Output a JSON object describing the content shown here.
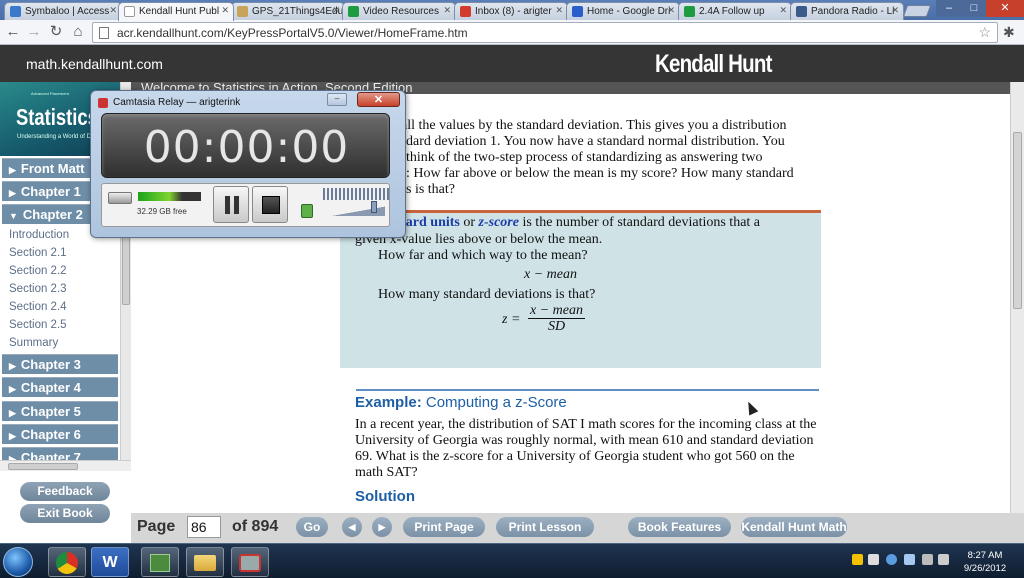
{
  "browser": {
    "tabs": [
      {
        "label": "Symbaloo | Access",
        "fav_color": "#3a78c9"
      },
      {
        "label": "Kendall Hunt Publ",
        "fav_color": "#ffffff",
        "active": true
      },
      {
        "label": "GPS_21Things4Edu",
        "fav_color": "#c8a35a"
      },
      {
        "label": "Video Resources",
        "fav_color": "#1e9b3e"
      },
      {
        "label": "Inbox (8) - arigter",
        "fav_color": "#d33b2c"
      },
      {
        "label": "Home - Google Dri",
        "fav_color": "#2a5fcb"
      },
      {
        "label": "2.4A Follow up",
        "fav_color": "#1e9b3e"
      },
      {
        "label": "Pandora Radio - Li",
        "fav_color": "#3a5a8c"
      }
    ],
    "url": "acr.kendallhunt.com/KeyPressPortalV5.0/Viewer/HomeFrame.htm",
    "window_buttons": [
      "–",
      "□",
      "✕"
    ]
  },
  "site": {
    "link": "math.kendallhunt.com",
    "logo": "Kendall Hunt",
    "welcome": "Welcome to Statistics in Action, Second Edition"
  },
  "book_cover": {
    "small": "Advanced Placement",
    "title": "Statistics",
    "subtitle": "Understanding a World of D"
  },
  "sidebar": {
    "chapters": [
      {
        "label": "Front Matt"
      },
      {
        "label": "Chapter 1"
      },
      {
        "label": "Chapter 2"
      },
      {
        "label": "Chapter 3"
      },
      {
        "label": "Chapter 4"
      },
      {
        "label": "Chapter 5"
      },
      {
        "label": "Chapter 6"
      },
      {
        "label": "Chapter 7"
      }
    ],
    "sections": [
      "Introduction",
      "Section 2.1",
      "Section 2.2",
      "Section 2.3",
      "Section 2.4",
      "Section 2.5",
      "Summary"
    ],
    "feedback": "Feedback",
    "exit_book": "Exit Book"
  },
  "content": {
    "para1": [
      "all the values by the standard deviation. This gives you a distribution",
      "dard deviation 1. You now have a standard normal distribution. You",
      "think of the two-step process of standardizing as answering two",
      ": How far above or below the mean is my score? How many standard",
      "s is that?"
    ],
    "def_keyword1": "dard units",
    "def_or": "or",
    "def_keyword2": "z-score",
    "def_rest": "is the number of standard deviations that a",
    "def_line2": "given x-value lies above or below the mean.",
    "q1": "How far and which way to the mean?",
    "formula1": "x − mean",
    "q2": "How many standard deviations is that?",
    "z_lhs": "z =",
    "z_num": "x − mean",
    "z_den": "SD",
    "example_label": "Example:",
    "example_title": "Computing a z-Score",
    "example_text": [
      "In a recent year, the distribution of SAT I math scores for the incoming class at the",
      "University of Georgia was roughly normal, with mean 610 and standard deviation",
      "69. What is the z-score for a University of Georgia student who got 560 on the",
      "math SAT?"
    ],
    "solution": "Solution"
  },
  "bottom": {
    "page_label": "Page",
    "page_value": "86",
    "of_label": "of 894",
    "go": "Go",
    "print_page": "Print Page",
    "print_lesson": "Print Lesson",
    "book_features": "Book Features",
    "kh_math": "Kendall Hunt Math"
  },
  "camtasia": {
    "title": "Camtasia Relay — arigterink",
    "timer": "00:00:00",
    "disk_free": "32.29 GB free",
    "close": "✕"
  },
  "taskbar": {
    "clock_time": "8:27 AM",
    "clock_date": "9/26/2012"
  }
}
